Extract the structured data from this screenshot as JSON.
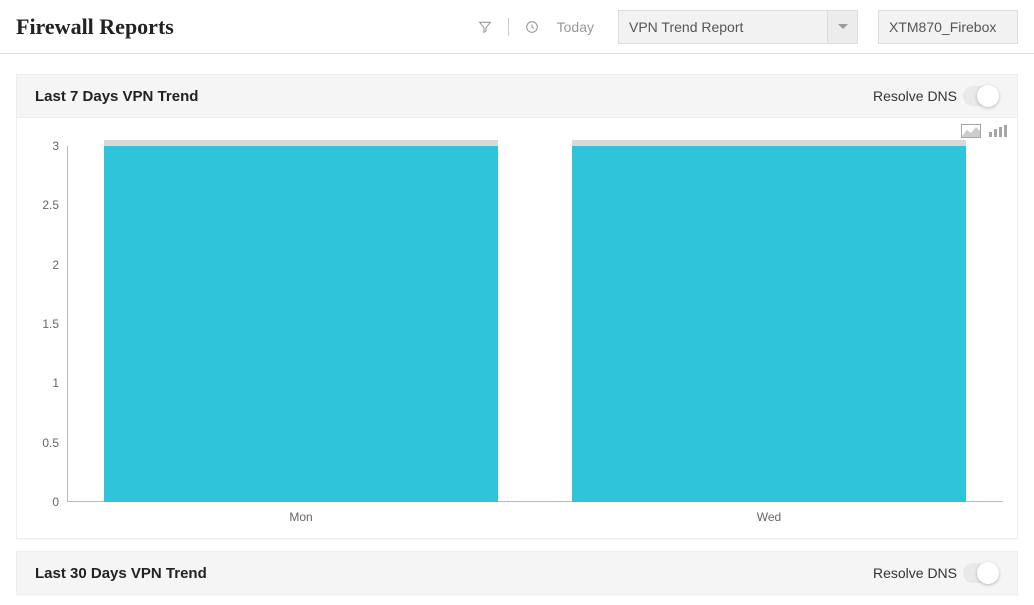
{
  "header": {
    "title": "Firewall Reports",
    "today_label": "Today",
    "report_select": "VPN Trend Report",
    "device_select": "XTM870_Firebox"
  },
  "panels": {
    "p0": {
      "title": "Last 7 Days VPN Trend",
      "dns_label": "Resolve DNS"
    },
    "p1": {
      "title": "Last 30 Days VPN Trend",
      "dns_label": "Resolve DNS"
    }
  },
  "chart_data": {
    "type": "bar",
    "categories": [
      "Mon",
      "Wed"
    ],
    "values": [
      3,
      3
    ],
    "title": "Last 7 Days VPN Trend",
    "xlabel": "",
    "ylabel": "",
    "ylim": [
      0,
      3
    ],
    "yticks": [
      0,
      0.5,
      1,
      1.5,
      2,
      2.5,
      3
    ]
  }
}
